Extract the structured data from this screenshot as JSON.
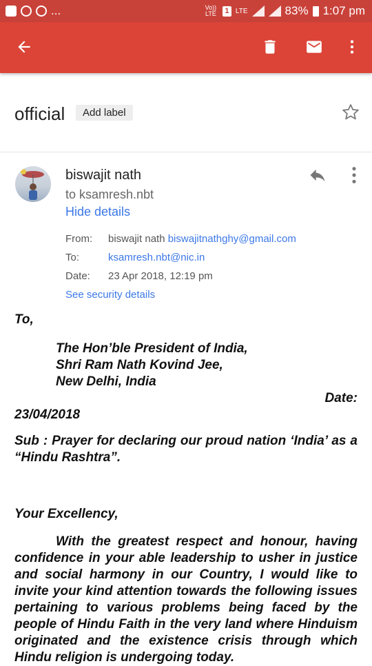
{
  "status_bar": {
    "notification_more": "...",
    "carrier_volte": "Vo)) LTE",
    "sim_badge": "1",
    "network": "LTE",
    "battery": "83%",
    "time": "1:07 pm"
  },
  "colors": {
    "status_bar": "#c9423a",
    "app_bar": "#db4437",
    "link": "#3b78e7"
  },
  "app_bar": {
    "icons": [
      "arrow-back-icon",
      "trash-icon",
      "mail-icon",
      "more-vert-icon"
    ]
  },
  "email": {
    "subject": "official",
    "add_label": "Add label",
    "sender_name": "biswajit nath",
    "to_short": "to ksamresh.nbt",
    "hide_details": "Hide details",
    "from_label": "From:",
    "from_name": "biswajit nath",
    "from_email": "biswajitnathghy@gmail.com",
    "to_label": "To:",
    "to_email": "ksamresh.nbt@nic.in",
    "date_label": "Date:",
    "date_value": "23 Apr 2018, 12:19 pm",
    "security_link": "See security details"
  },
  "letter": {
    "salutation_to": "To,",
    "addr_1": "The Hon’ble President of India,",
    "addr_2": "Shri Ram Nath Kovind Jee,",
    "addr_3": "New Delhi, India",
    "date_label": "Date:",
    "date_value": "23/04/2018",
    "subject": "Sub : Prayer for declaring our proud nation ‘India’ as a “Hindu Rashtra”.",
    "greeting": "Your Excellency,",
    "paragraph": "With the greatest respect and honour, having confidence in your able leadership to usher in justice and social harmony in our Country, I would like to invite your kind attention towards the following issues pertaining to various problems being faced by the people of Hindu Faith in the very land where Hinduism originated and the existence crisis through which Hindu religion is undergoing today."
  }
}
